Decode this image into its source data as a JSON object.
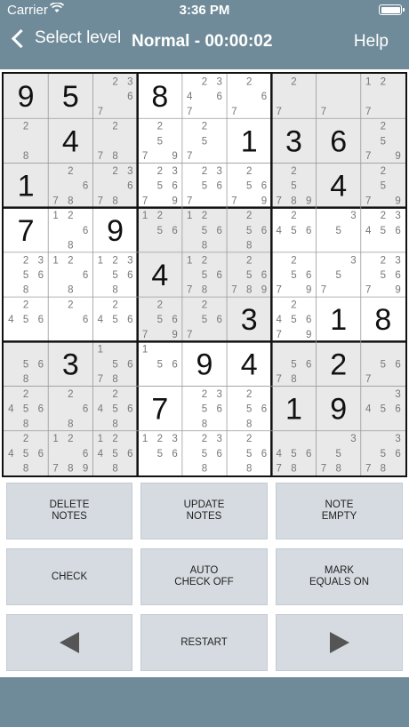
{
  "status": {
    "carrier": "Carrier",
    "time": "3:36 PM"
  },
  "nav": {
    "back_label": "Select level",
    "title": "Normal - 00:00:02",
    "help_label": "Help"
  },
  "board": {
    "grid": [
      [
        "9",
        "5",
        [
          "2",
          "3",
          "6",
          "7"
        ],
        "8",
        [
          "2",
          "3",
          "4",
          "6",
          "7"
        ],
        [
          "2",
          "6",
          "7"
        ],
        [
          "2",
          "7"
        ],
        [
          "7"
        ],
        [
          "1",
          "2",
          "7"
        ]
      ],
      [
        [
          "2",
          "8"
        ],
        "4",
        [
          "2",
          "7",
          "8"
        ],
        [
          "2",
          "5",
          "9",
          "7"
        ],
        [
          "2",
          "5",
          "7"
        ],
        "1",
        "3",
        "6",
        [
          "2",
          "5",
          "7",
          "9"
        ]
      ],
      [
        "1",
        [
          "2",
          "6",
          "7",
          "8"
        ],
        [
          "2",
          "3",
          "6",
          "7",
          "8"
        ],
        [
          "2",
          "3",
          "5",
          "6",
          "9",
          "7"
        ],
        [
          "2",
          "3",
          "5",
          "6",
          "7"
        ],
        [
          "2",
          "5",
          "6",
          "7",
          "9"
        ],
        [
          "2",
          "5",
          "7",
          "8",
          "9"
        ],
        "4",
        [
          "2",
          "5",
          "7",
          "9"
        ]
      ],
      [
        "7",
        [
          "1",
          "2",
          "6",
          "8"
        ],
        "9",
        [
          "1",
          "2",
          "5",
          "6"
        ],
        [
          "1",
          "2",
          "5",
          "6",
          "8"
        ],
        [
          "2",
          "5",
          "6",
          "8"
        ],
        [
          "2",
          "4",
          "5",
          "6"
        ],
        [
          "3",
          "5"
        ],
        [
          "2",
          "3",
          "4",
          "5",
          "6"
        ]
      ],
      [
        [
          "2",
          "3",
          "5",
          "6",
          "8"
        ],
        [
          "1",
          "2",
          "6",
          "8"
        ],
        [
          "1",
          "2",
          "3",
          "5",
          "6",
          "8"
        ],
        "4",
        [
          "1",
          "2",
          "5",
          "6",
          "7",
          "8"
        ],
        [
          "2",
          "5",
          "6",
          "7",
          "8",
          "9"
        ],
        [
          "2",
          "5",
          "6",
          "7",
          "9"
        ],
        [
          "3",
          "5",
          "7"
        ],
        [
          "2",
          "3",
          "5",
          "6",
          "7",
          "9"
        ]
      ],
      [
        [
          "2",
          "4",
          "5",
          "6"
        ],
        [
          "2",
          "6"
        ],
        [
          "2",
          "4",
          "5",
          "6"
        ],
        [
          "2",
          "5",
          "6",
          "9",
          "7"
        ],
        [
          "2",
          "5",
          "6",
          "7"
        ],
        "3",
        [
          "2",
          "4",
          "5",
          "6",
          "7",
          "9"
        ],
        "1",
        "8"
      ],
      [
        [
          "5",
          "6",
          "8"
        ],
        "3",
        [
          "1",
          "5",
          "6",
          "7",
          "8"
        ],
        [
          "1",
          "5",
          "6"
        ],
        "9",
        "4",
        [
          "5",
          "6",
          "7",
          "8"
        ],
        "2",
        [
          "5",
          "6",
          "7"
        ]
      ],
      [
        [
          "2",
          "4",
          "5",
          "6",
          "8"
        ],
        [
          "2",
          "6",
          "8"
        ],
        [
          "2",
          "4",
          "5",
          "6",
          "8"
        ],
        "7",
        [
          "2",
          "3",
          "5",
          "6",
          "8"
        ],
        [
          "2",
          "5",
          "6",
          "8"
        ],
        "1",
        "9",
        [
          "3",
          "4",
          "5",
          "6"
        ]
      ],
      [
        [
          "2",
          "4",
          "5",
          "6",
          "8"
        ],
        [
          "1",
          "2",
          "6",
          "7",
          "8",
          "9"
        ],
        [
          "1",
          "2",
          "4",
          "5",
          "6",
          "8"
        ],
        [
          "1",
          "2",
          "3",
          "5",
          "6"
        ],
        [
          "2",
          "3",
          "5",
          "6",
          "8"
        ],
        [
          "2",
          "5",
          "6",
          "8"
        ],
        [
          "4",
          "5",
          "6",
          "7",
          "8"
        ],
        [
          "3",
          "5",
          "7",
          "8"
        ],
        [
          "3",
          "5",
          "6",
          "7",
          "8"
        ]
      ]
    ]
  },
  "controls": {
    "delete_notes": "DELETE\nNOTES",
    "update_notes": "UPDATE\nNOTES",
    "note_empty": "NOTE\nEMPTY",
    "check": "CHECK",
    "auto_check": "AUTO\nCHECK OFF",
    "mark_equals": "MARK\nEQUALS ON",
    "restart": "RESTART",
    "prev_icon": "triangle-left-icon",
    "next_icon": "triangle-right-icon"
  },
  "colors": {
    "background": "#6f8b99",
    "cell_shaded": "#e9e9e9",
    "cell_white": "#ffffff",
    "button_bg": "#d5dbe0"
  }
}
